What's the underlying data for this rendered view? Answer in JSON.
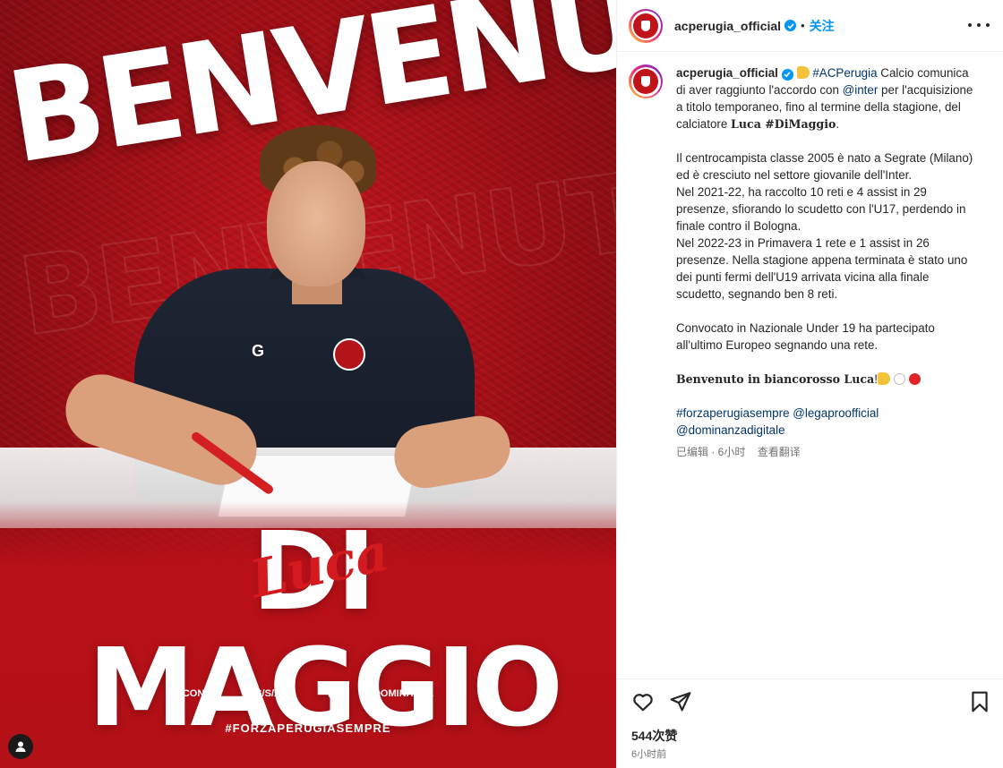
{
  "post_image": {
    "headline": "BENVENUTO",
    "first_name_script": "Luca",
    "last_name": "DI MAGGIO",
    "sponsors": [
      "CONAD",
      "/S/S/A/S/",
      "DOMINANZA"
    ],
    "hashtag": "#FORZAPERUGIASEMPRE",
    "user_tag_icon": "person-icon"
  },
  "header": {
    "username": "acperugia_official",
    "verified_icon": "verified-badge-icon",
    "separator": "•",
    "follow_label": "关注",
    "more_icon": "more-options-icon"
  },
  "caption": {
    "username": "acperugia_official",
    "p1_tag": "#ACPerugia",
    "p1_a": " Calcio comunica di aver raggiunto l'accordo con ",
    "p1_mention": "@inter",
    "p1_b": " per l'acquisizione a titolo temporaneo, fino al termine della stagione, del calciatore ",
    "p1_bold": "Luca #DiMaggio",
    "p1_end": ".",
    "p2": "Il centrocampista classe 2005 è nato a Segrate (Milano) ed è cresciuto nel settore giovanile dell'Inter.",
    "p3": "Nel 2021-22, ha raccolto 10 reti e 4 assist in 29 presenze, sfiorando lo scudetto con l'U17, perdendo in finale contro il Bologna.",
    "p4": "Nel 2022-23 in Primavera 1 rete e 1 assist in 26 presenze. Nella stagione appena terminata è stato uno dei punti fermi dell'U19 arrivata vicina alla finale scudetto, segnando ben 8 reti.",
    "p5": "Convocato in Nazionale Under 19 ha partecipato all'ultimo Europeo segnando una rete.",
    "p6_bold": "Benvenuto in biancorosso Luca",
    "p6_end": "!",
    "tag1": "#forzaperugiasempre",
    "mention1": "@legaproofficial",
    "mention2": "@dominanzadigitale",
    "meta_edited": "已编辑 · 6小时",
    "meta_translate": "查看翻译"
  },
  "footer": {
    "likes": "544次赞",
    "time": "6小时前",
    "like_icon": "heart-icon",
    "share_icon": "send-icon",
    "save_icon": "bookmark-icon"
  },
  "colors": {
    "club_red": "#c0131a",
    "link": "#00376b",
    "follow_blue": "#0095f6",
    "verified_blue": "#0095f6"
  }
}
